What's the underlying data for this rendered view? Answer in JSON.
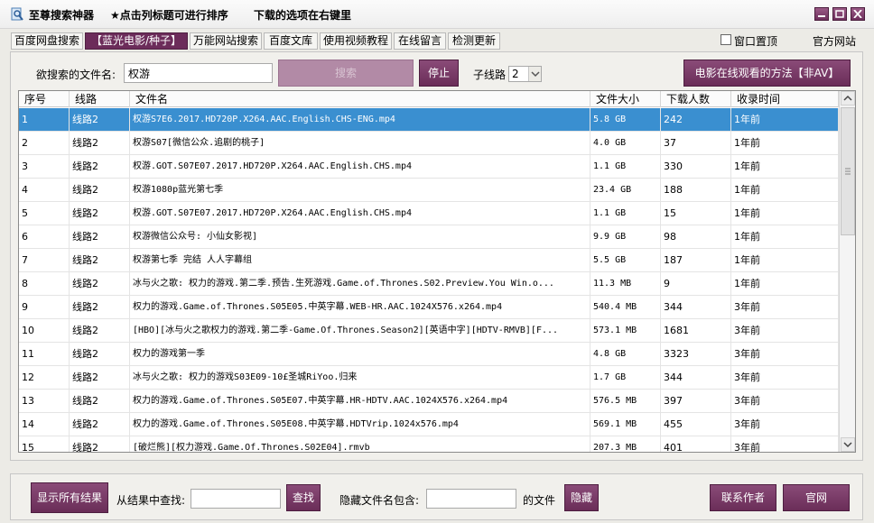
{
  "title_bar": {
    "app_name": "至尊搜索神器",
    "hint_sort": "★点击列标题可进行排序",
    "hint_download": "下载的选项在右键里"
  },
  "tabs": [
    "百度网盘搜索",
    "【蓝光电影/种子】",
    "万能网站搜索",
    "百度文库",
    "使用视频教程",
    "在线留言",
    "检测更新"
  ],
  "active_tab": 1,
  "top_right": {
    "checkbox_label": "窗口置顶",
    "official_site": "官方网站"
  },
  "search": {
    "label": "欲搜索的文件名:",
    "value": "权游",
    "search_button": "搜索",
    "stop_button": "停止",
    "subline_label": "子线路",
    "subline_value": "2",
    "online_button": "电影在线观看的方法【非AV】"
  },
  "table": {
    "columns": [
      "序号",
      "线路",
      "文件名",
      "文件大小",
      "下载人数",
      "收录时间"
    ],
    "rows": [
      {
        "no": "1",
        "line": "线路2",
        "name": "权游S7E6.2017.HD720P.X264.AAC.English.CHS-ENG.mp4",
        "size": "5.8  GB",
        "downloads": "242",
        "time": "1年前"
      },
      {
        "no": "2",
        "line": "线路2",
        "name": "权游S07[微信公众.追剧的桃子]",
        "size": "4.0  GB",
        "downloads": "37",
        "time": "1年前"
      },
      {
        "no": "3",
        "line": "线路2",
        "name": "权游.GOT.S07E07.2017.HD720P.X264.AAC.English.CHS.mp4",
        "size": "1.1  GB",
        "downloads": "330",
        "time": "1年前"
      },
      {
        "no": "4",
        "line": "线路2",
        "name": "权游1080p蓝光第七季",
        "size": "23.4  GB",
        "downloads": "188",
        "time": "1年前"
      },
      {
        "no": "5",
        "line": "线路2",
        "name": "权游.GOT.S07E07.2017.HD720P.X264.AAC.English.CHS.mp4",
        "size": "1.1  GB",
        "downloads": "15",
        "time": "1年前"
      },
      {
        "no": "6",
        "line": "线路2",
        "name": "权游微信公众号: 小仙女影视]",
        "size": "9.9  GB",
        "downloads": "98",
        "time": "1年前"
      },
      {
        "no": "7",
        "line": "线路2",
        "name": "权游第七季 完结 人人字幕组",
        "size": "5.5  GB",
        "downloads": "187",
        "time": "1年前"
      },
      {
        "no": "8",
        "line": "线路2",
        "name": "冰与火之歌: 权力的游戏.第二季.预告.生死游戏.Game.of.Thrones.S02.Preview.You Win.o...",
        "size": "11.3  MB",
        "downloads": "9",
        "time": "1年前"
      },
      {
        "no": "9",
        "line": "线路2",
        "name": "权力的游戏.Game.of.Thrones.S05E05.中英字幕.WEB-HR.AAC.1024X576.x264.mp4",
        "size": "540.4  MB",
        "downloads": "344",
        "time": "3年前"
      },
      {
        "no": "10",
        "line": "线路2",
        "name": "[HBO][冰与火之歌权力的游戏.第二季-Game.Of.Thrones.Season2][英语中字][HDTV-RMVB][F...",
        "size": "573.1  MB",
        "downloads": "1681",
        "time": "3年前"
      },
      {
        "no": "11",
        "line": "线路2",
        "name": "权力的游戏第一季",
        "size": "4.8  GB",
        "downloads": "3323",
        "time": "3年前"
      },
      {
        "no": "12",
        "line": "线路2",
        "name": "冰与火之歌: 权力的游戏S03E09-10£圣城RiYoo.归来",
        "size": "1.7  GB",
        "downloads": "344",
        "time": "3年前"
      },
      {
        "no": "13",
        "line": "线路2",
        "name": "权力的游戏.Game.of.Thrones.S05E07.中英字幕.HR-HDTV.AAC.1024X576.x264.mp4",
        "size": "576.5  MB",
        "downloads": "397",
        "time": "3年前"
      },
      {
        "no": "14",
        "line": "线路2",
        "name": "权力的游戏.Game.of.Thrones.S05E08.中英字幕.HDTVrip.1024x576.mp4",
        "size": "569.1  MB",
        "downloads": "455",
        "time": "3年前"
      },
      {
        "no": "15",
        "line": "线路2",
        "name": "[破烂熊][权力游戏.Game.Of.Thrones.S02E04].rmvb",
        "size": "207.3  MB",
        "downloads": "401",
        "time": "3年前"
      }
    ],
    "selected_row": 0
  },
  "bottom": {
    "show_all_button": "显示所有结果",
    "find_label": "从结果中查找:",
    "find_value": "",
    "find_button": "查找",
    "hide_label": "隐藏文件名包含:",
    "hide_value": "",
    "hide_suffix": "的文件",
    "hide_button": "隐藏",
    "contact_button": "联系作者",
    "website_button": "官网"
  },
  "colors": {
    "accent": "#6c2c5a",
    "selection": "#3a8fd0",
    "background": "#ecebe6"
  },
  "icons": [
    "app-search-icon",
    "minimize-icon",
    "maximize-icon",
    "close-icon",
    "chevron-down-icon",
    "chevron-up-icon"
  ]
}
